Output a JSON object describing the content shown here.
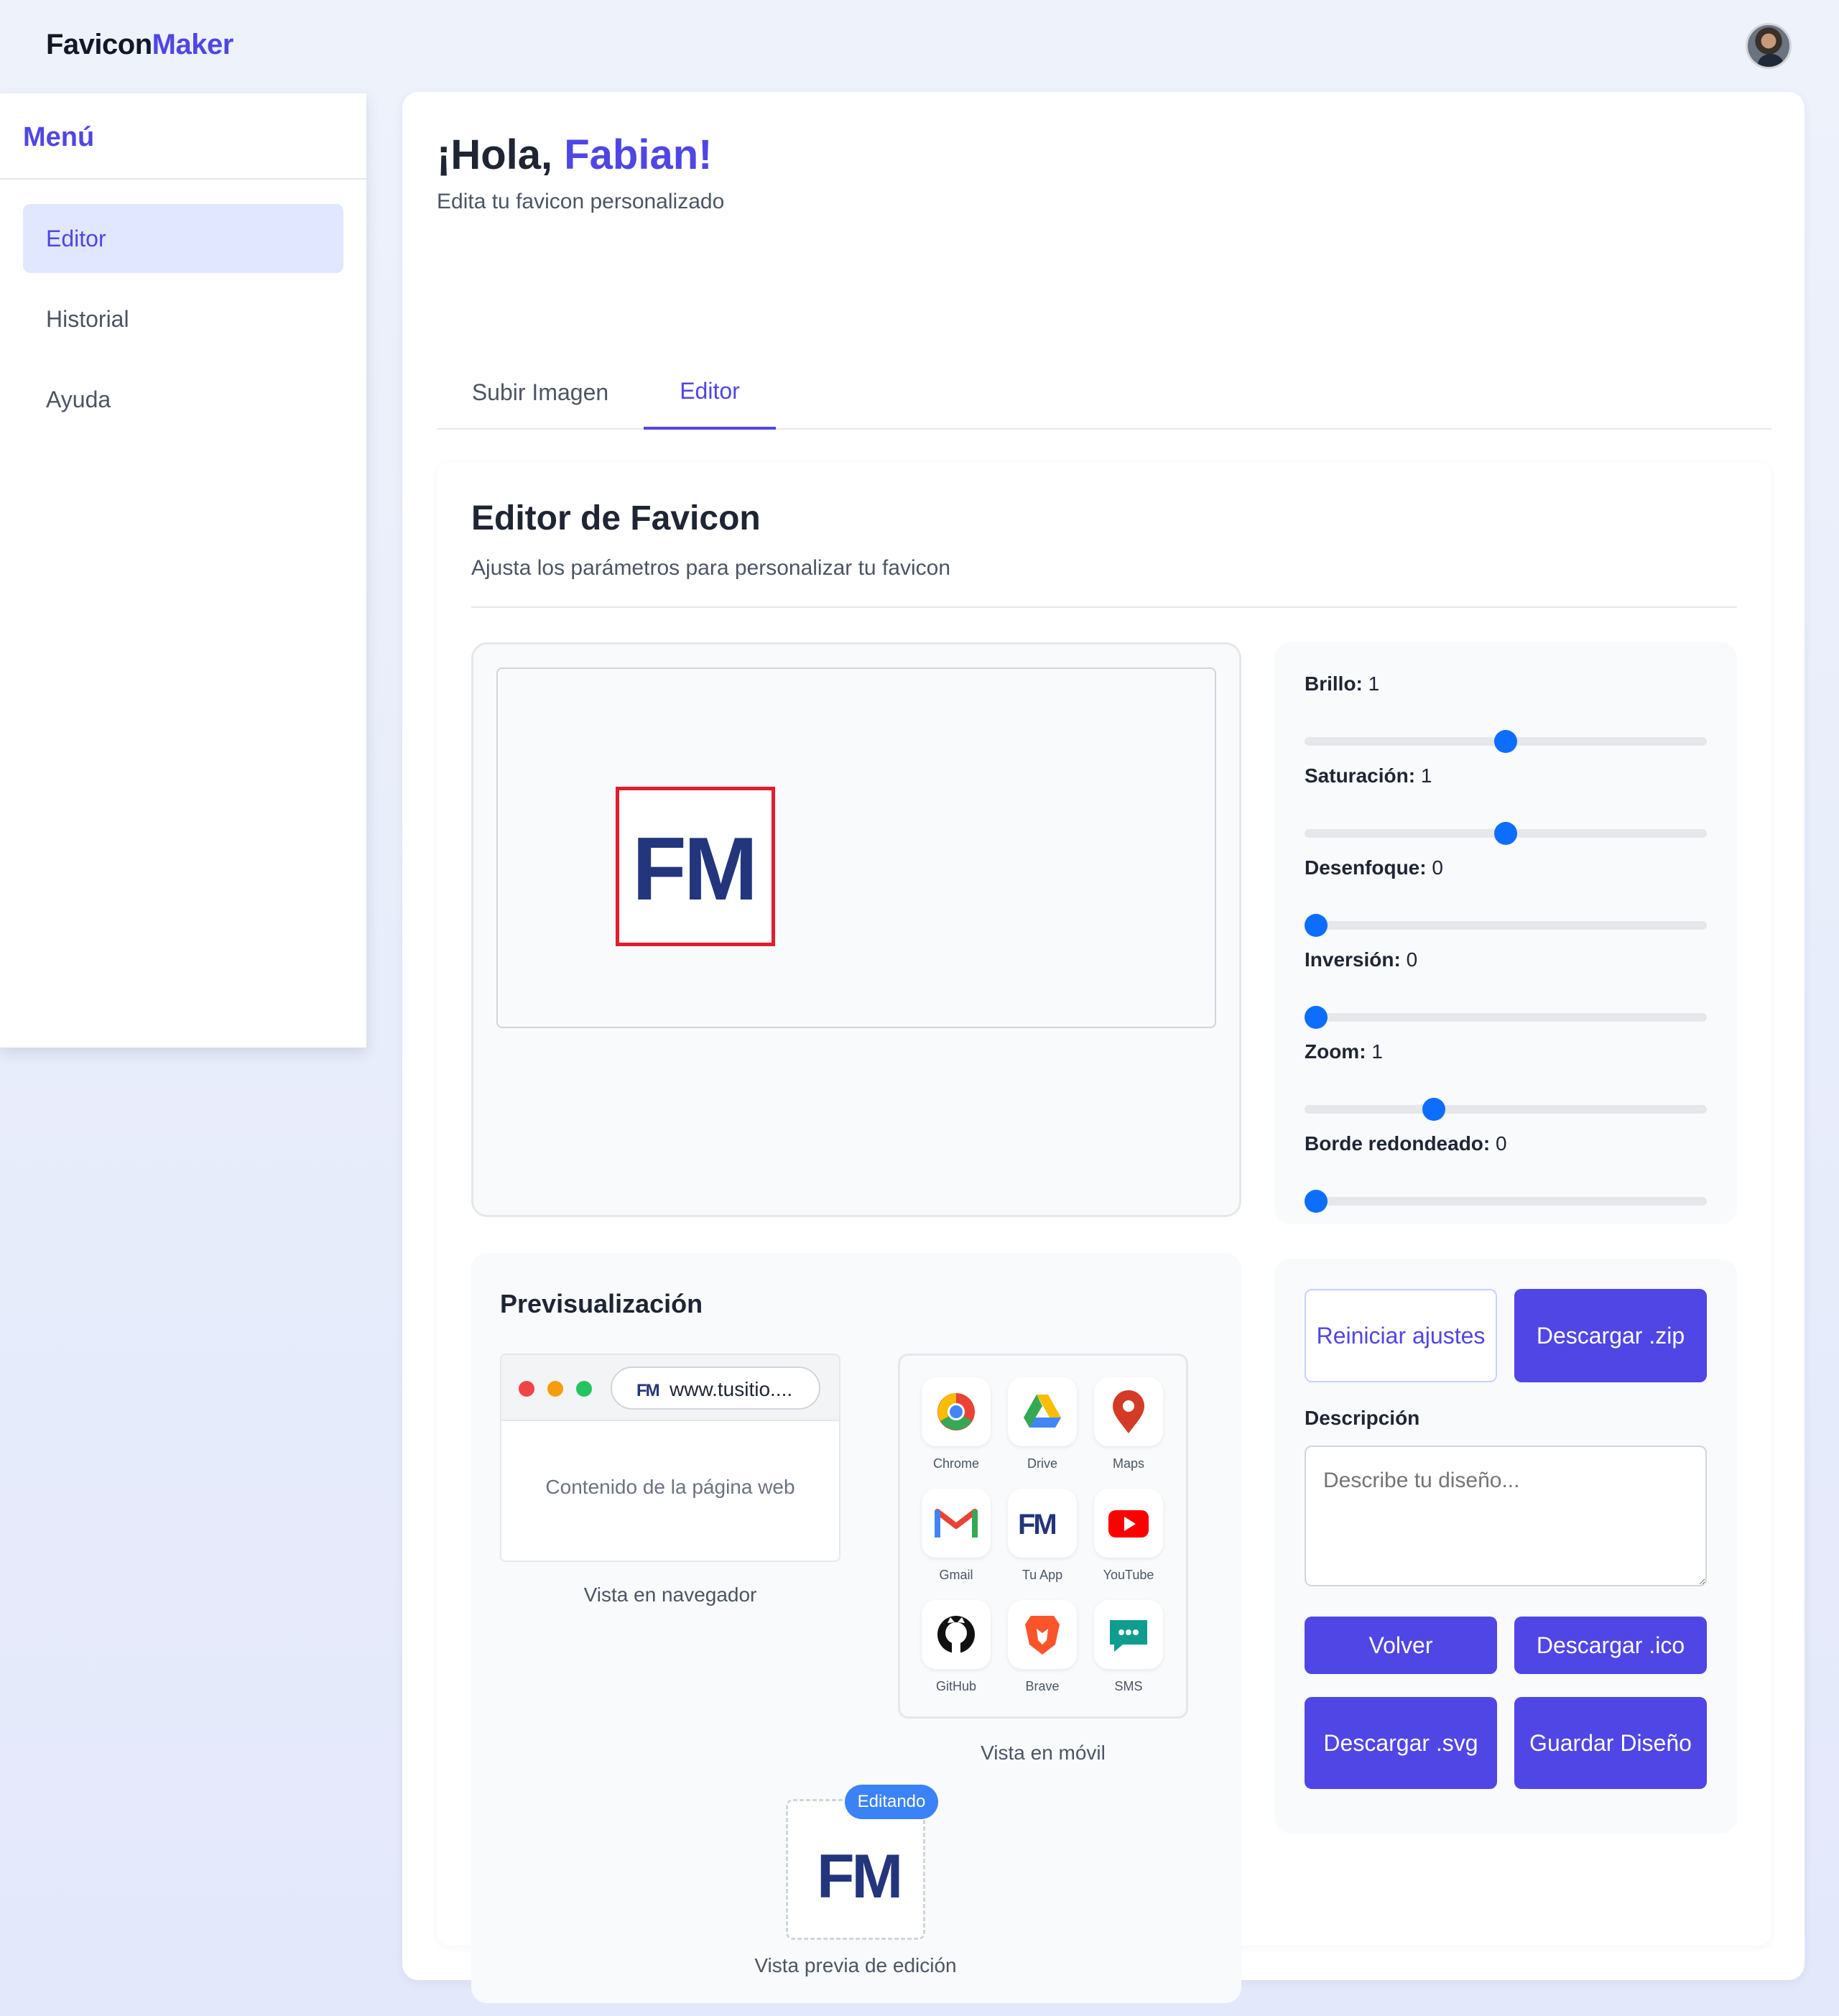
{
  "brand": {
    "part1": "Favicon",
    "part2": "Maker"
  },
  "sidebar": {
    "title": "Menú",
    "items": [
      {
        "label": "Editor",
        "active": true
      },
      {
        "label": "Historial",
        "active": false
      },
      {
        "label": "Ayuda",
        "active": false
      }
    ]
  },
  "header": {
    "greeting_prefix": "¡Hola, ",
    "user_name": "Fabian!",
    "subtitle": "Edita tu favicon personalizado"
  },
  "tabs": [
    {
      "label": "Subir Imagen",
      "active": false
    },
    {
      "label": "Editor",
      "active": true
    }
  ],
  "editor": {
    "title": "Editor de Favicon",
    "subtitle": "Ajusta los parámetros para personalizar tu favicon",
    "logo_text": "FM"
  },
  "controls": [
    {
      "label": "Brillo:",
      "value": "1",
      "level": 0.5
    },
    {
      "label": "Saturación:",
      "value": "1",
      "level": 0.5
    },
    {
      "label": "Desenfoque:",
      "value": "0",
      "level": 0.0
    },
    {
      "label": "Inversión:",
      "value": "0",
      "level": 0.0
    },
    {
      "label": "Zoom:",
      "value": "1",
      "level": 0.31
    },
    {
      "label": "Borde redondeado:",
      "value": "0",
      "level": 0.0
    }
  ],
  "preview": {
    "title": "Previsualización",
    "browser": {
      "url": "www.tusitio....",
      "body_text": "Contenido de la página web",
      "caption": "Vista en navegador"
    },
    "mobile": {
      "apps": [
        "Chrome",
        "Drive",
        "Maps",
        "Gmail",
        "Tu App",
        "YouTube",
        "GitHub",
        "Brave",
        "SMS"
      ],
      "caption": "Vista en móvil"
    },
    "edit": {
      "badge": "Editando",
      "caption": "Vista previa de edición"
    }
  },
  "actions": {
    "reset": "Reiniciar ajustes",
    "download_zip": "Descargar .zip",
    "description_label": "Descripción",
    "description_placeholder": "Describe tu diseño...",
    "back": "Volver",
    "download_ico": "Descargar .ico",
    "download_svg": "Descargar .svg",
    "save_design": "Guardar Diseño"
  },
  "colors": {
    "accent": "#4f46e5",
    "slider_thumb": "#0d6efd",
    "logo_blue": "#23357c",
    "frame_red": "#e11d2e",
    "badge_blue": "#3b82f6"
  }
}
